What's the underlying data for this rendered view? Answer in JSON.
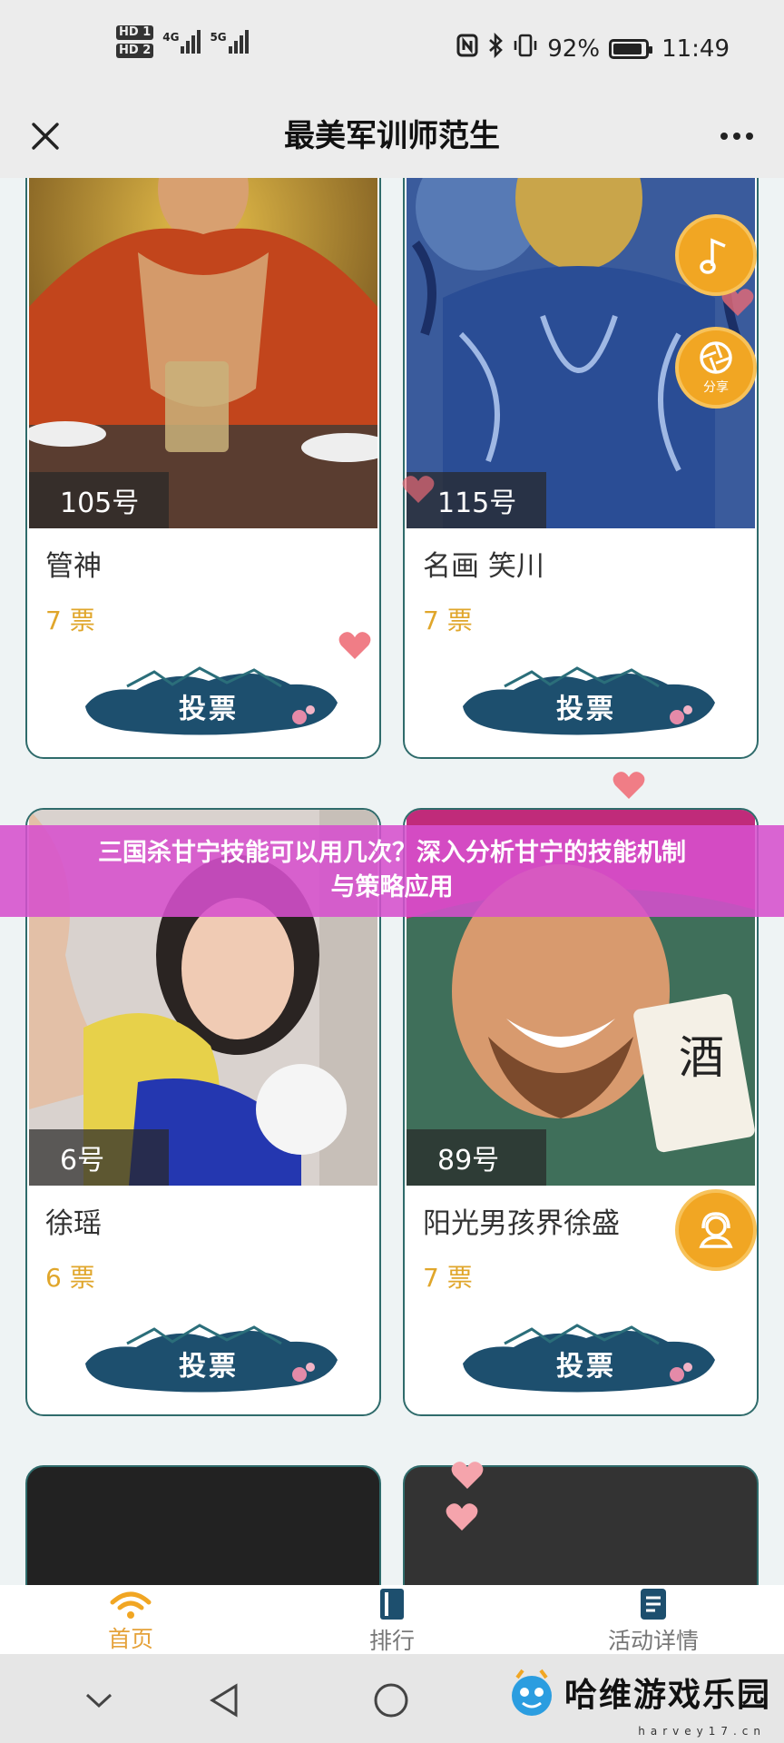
{
  "status_bar": {
    "hd1": "HD 1",
    "hd2": "HD 2",
    "net1": "4G",
    "net2": "5G",
    "battery_text": "92%",
    "battery_level": 0.92,
    "time": "11:49"
  },
  "header": {
    "title": "最美军训师范生"
  },
  "cards": [
    {
      "number": "105号",
      "name": "管神",
      "votes": "7 票",
      "vote_label": "投票"
    },
    {
      "number": "115号",
      "name": "名画 笑川",
      "votes": "7 票",
      "vote_label": "投票"
    },
    {
      "number": "6号",
      "name": "徐瑶",
      "votes": "6 票",
      "vote_label": "投票"
    },
    {
      "number": "89号",
      "name": "阳光男孩界徐盛",
      "votes": "7 票",
      "vote_label": "投票"
    }
  ],
  "floating": {
    "share_label": "分享"
  },
  "banner": {
    "line1": "三国杀甘宁技能可以用几次？深入分析甘宁的技能机制",
    "line2": "与策略应用"
  },
  "tabs": [
    {
      "label": "首页",
      "icon": "home-icon",
      "active": true
    },
    {
      "label": "排行",
      "icon": "ranking-icon",
      "active": false
    },
    {
      "label": "活动详情",
      "icon": "details-icon",
      "active": false
    }
  ],
  "watermark": {
    "text": "哈维游戏乐园",
    "url": "harvey17.cn"
  },
  "colors": {
    "accent": "#f1a623",
    "card_border": "#2f6b6b",
    "vote_color": "#e0a62b",
    "banner": "#d650cd"
  }
}
